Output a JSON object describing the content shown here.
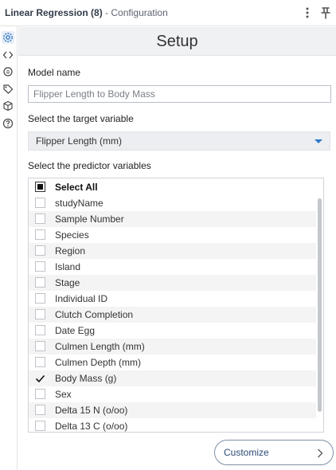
{
  "titlebar": {
    "tool_name": "Linear Regression (8)",
    "suffix": "- Configuration"
  },
  "sidebar": {
    "icons": [
      "gear-icon",
      "code-icon",
      "bug-icon",
      "tag-icon",
      "box-icon",
      "help-icon"
    ],
    "active": "gear-icon"
  },
  "header": {
    "title": "Setup"
  },
  "model_name": {
    "label": "Model name",
    "value": "Flipper Length to Body Mass"
  },
  "target": {
    "label": "Select the target variable",
    "selected": "Flipper Length (mm)"
  },
  "predictors": {
    "label": "Select the predictor variables",
    "select_all": "Select All",
    "items": [
      {
        "label": "studyName",
        "checked": false
      },
      {
        "label": "Sample Number",
        "checked": false
      },
      {
        "label": "Species",
        "checked": false
      },
      {
        "label": "Region",
        "checked": false
      },
      {
        "label": "Island",
        "checked": false
      },
      {
        "label": "Stage",
        "checked": false
      },
      {
        "label": "Individual ID",
        "checked": false
      },
      {
        "label": "Clutch Completion",
        "checked": false
      },
      {
        "label": "Date Egg",
        "checked": false
      },
      {
        "label": "Culmen Length (mm)",
        "checked": false
      },
      {
        "label": "Culmen Depth (mm)",
        "checked": false
      },
      {
        "label": "Body Mass (g)",
        "checked": true
      },
      {
        "label": "Sex",
        "checked": false
      },
      {
        "label": "Delta 15 N (o/oo)",
        "checked": false
      },
      {
        "label": "Delta 13 C (o/oo)",
        "checked": false
      }
    ]
  },
  "customize": {
    "label": "Customize"
  },
  "colors": {
    "accent": "#2e79c7",
    "button_text": "#2b4a75"
  }
}
